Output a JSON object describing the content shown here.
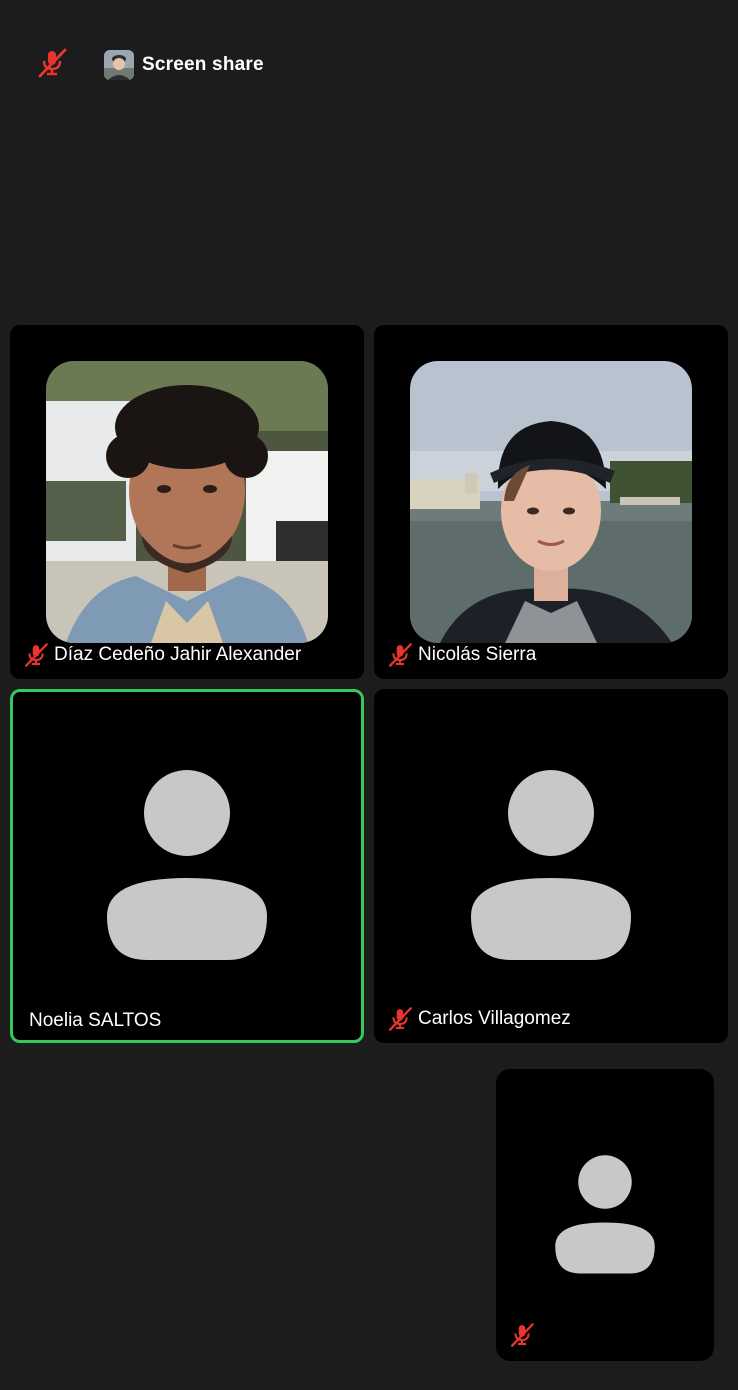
{
  "colors": {
    "background": "#1c1c1d",
    "tile": "#000000",
    "muted": "#e8352e",
    "active_speaker": "#35c85a",
    "avatar_placeholder": "#c8c8c8"
  },
  "topbar": {
    "mute_icon": "mic-off-icon",
    "screen_share_label": "Screen share"
  },
  "participants": [
    {
      "name": "Díaz Cedeño Jahir Alexander",
      "muted": true,
      "video": true
    },
    {
      "name": "Nicolás Sierra",
      "muted": true,
      "video": true
    },
    {
      "name": "Noelia SALTOS",
      "muted": false,
      "video": false,
      "active_speaker": true
    },
    {
      "name": "Carlos Villagomez",
      "muted": true,
      "video": false
    }
  ],
  "self_view": {
    "muted": true,
    "video": false
  }
}
